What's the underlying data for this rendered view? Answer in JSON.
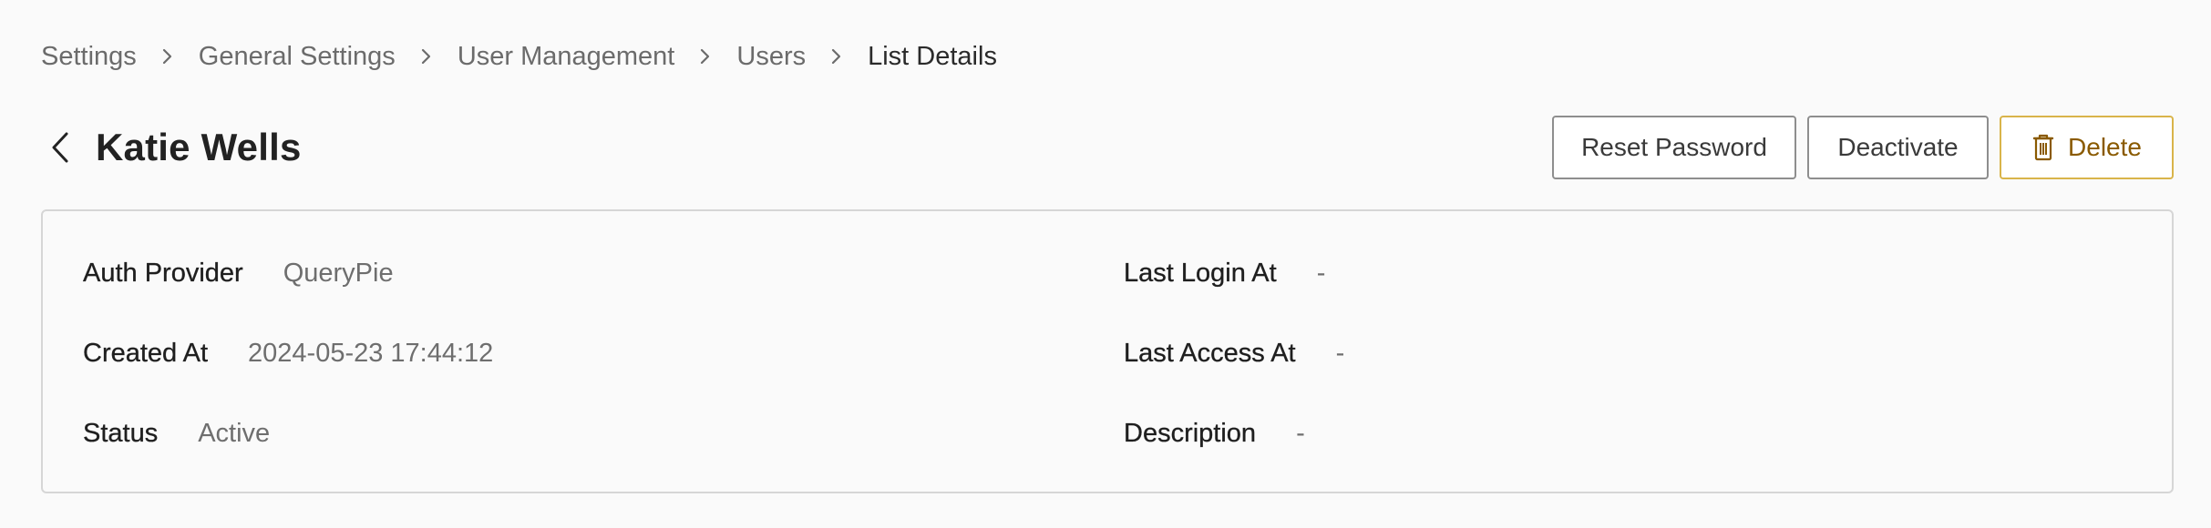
{
  "breadcrumb": {
    "items": [
      {
        "label": "Settings"
      },
      {
        "label": "General Settings"
      },
      {
        "label": "User Management"
      },
      {
        "label": "Users"
      },
      {
        "label": "List Details"
      }
    ]
  },
  "header": {
    "title": "Katie Wells",
    "actions": {
      "reset_password": "Reset Password",
      "deactivate": "Deactivate",
      "delete": "Delete"
    }
  },
  "details": {
    "auth_provider": {
      "label": "Auth Provider",
      "value": "QueryPie"
    },
    "created_at": {
      "label": "Created At",
      "value": "2024-05-23 17:44:12"
    },
    "status": {
      "label": "Status",
      "value": "Active"
    },
    "last_login_at": {
      "label": "Last Login At",
      "value": "-"
    },
    "last_access_at": {
      "label": "Last Access At",
      "value": "-"
    },
    "description": {
      "label": "Description",
      "value": "-"
    }
  },
  "icons": {
    "breadcrumb_separator": "chevron-right-icon",
    "back": "chevron-left-icon",
    "delete": "trash-icon"
  },
  "colors": {
    "background": "#fafafa",
    "delete_border": "#d9b44a",
    "delete_text": "#8a5a00"
  }
}
